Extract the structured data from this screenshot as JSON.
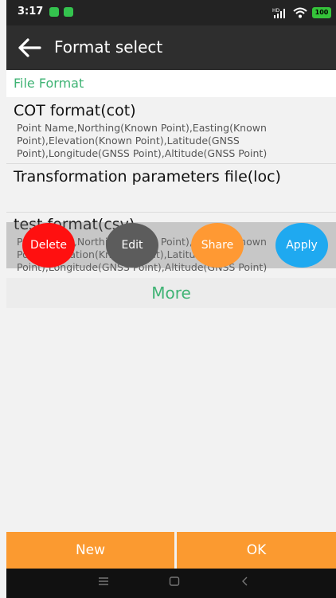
{
  "status_bar": {
    "time": "3:17",
    "battery": "100",
    "signal_label": "HD"
  },
  "header": {
    "back_icon": "arrow-left-icon",
    "title": "Format select"
  },
  "section": {
    "title": "File Format"
  },
  "formats": [
    {
      "title": "COT format(cot)",
      "description": "Point Name,Northing(Known Point),Easting(Known Point),Elevation(Known Point),Latitude(GNSS Point),Longitude(GNSS Point),Altitude(GNSS Point)"
    },
    {
      "title": "Transformation parameters file(loc)",
      "description": ""
    },
    {
      "title": "test format(csv)",
      "description": "Point Name,Northing(Known Point),Easting(Known Point),Elevation(Known Point),Latitude(GNSS Point),Longitude(GNSS Point),Altitude(GNSS Point)"
    }
  ],
  "actions": {
    "delete": "Delete",
    "edit": "Edit",
    "share": "Share",
    "apply": "Apply"
  },
  "more_label": "More",
  "footer": {
    "new_label": "New",
    "ok_label": "OK"
  },
  "colors": {
    "accent_green": "#3fb374",
    "orange": "#fb9a30",
    "delete_red": "#ff1010",
    "edit_gray": "#5c5c5c",
    "share_orange": "#ff9933",
    "apply_blue": "#1fa9f0"
  },
  "nav_icons": [
    "menu-icon",
    "home-icon",
    "back-icon"
  ]
}
